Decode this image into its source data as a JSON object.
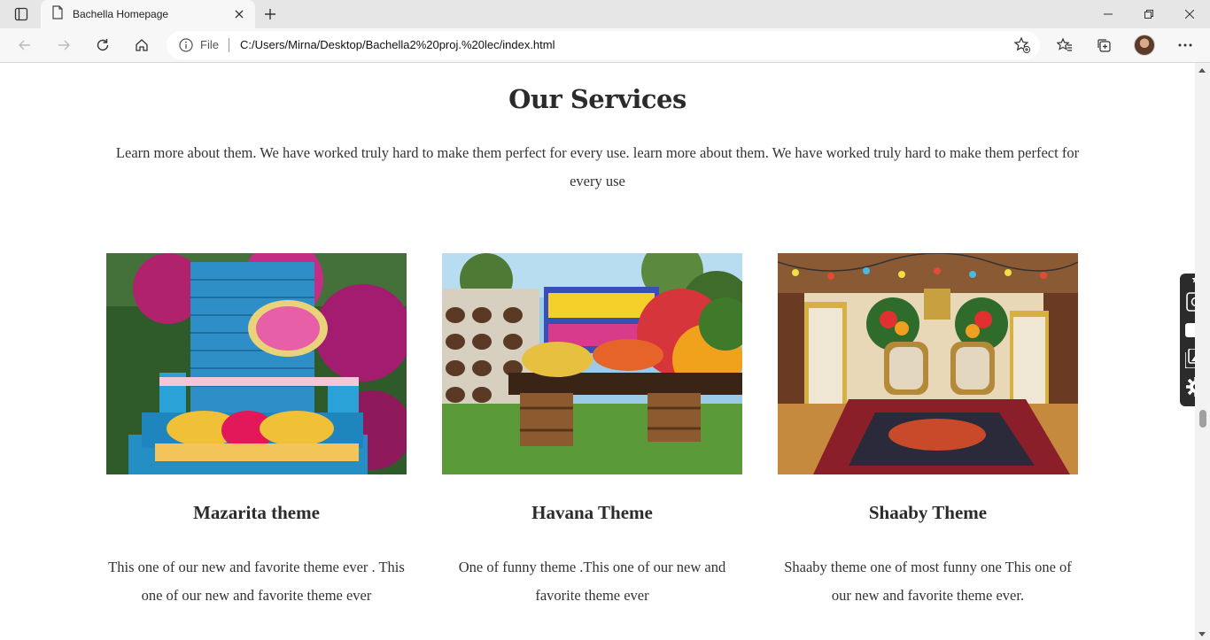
{
  "browser": {
    "tab_title": "Bachella Homepage",
    "address_prefix": "File",
    "url": "C:/Users/Mirna/Desktop/Bachella2%20proj.%20lec/index.html"
  },
  "page": {
    "title": "Our Services",
    "lead": "Learn more about them. We have worked truly hard to make them perfect for every use. learn more about them. We have worked truly hard to make them perfect for every use"
  },
  "services": [
    {
      "title": "Mazarita theme",
      "text": "This one of our new and favorite theme ever . This one of our new and favorite theme ever",
      "image_alt": "Mazarita theme photo"
    },
    {
      "title": "Havana Theme",
      "text": "One of funny theme .This one of our new and favorite theme ever",
      "image_alt": "Havana theme photo"
    },
    {
      "title": "Shaaby Theme",
      "text": "Shaaby theme one of most funny one This one of our new and favorite theme ever.",
      "image_alt": "Shaaby theme photo"
    }
  ],
  "colors": {
    "heading": "#2b2b2b",
    "body_text": "#333333",
    "chrome_bg": "#e6e6e6"
  }
}
